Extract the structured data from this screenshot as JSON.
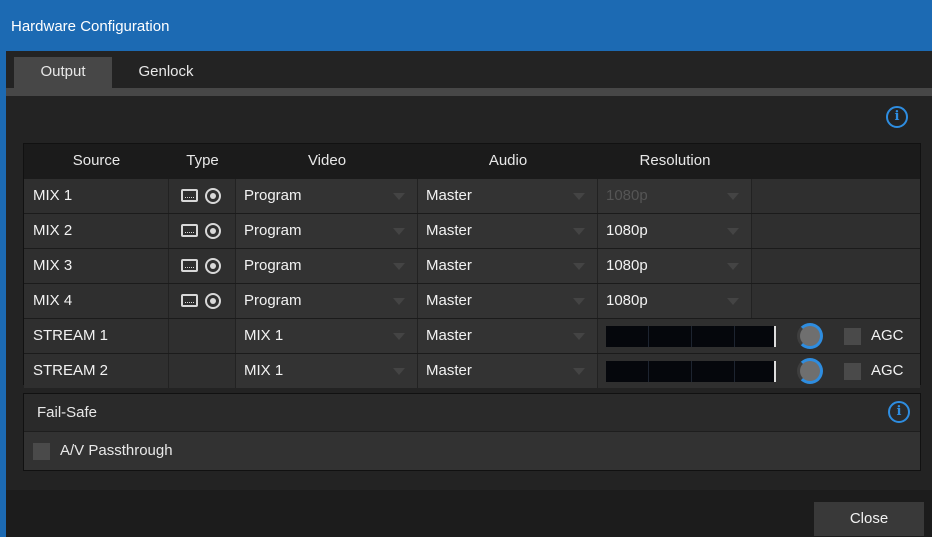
{
  "window": {
    "title": "Hardware Configuration"
  },
  "tabs": [
    {
      "label": "Output",
      "active": true
    },
    {
      "label": "Genlock",
      "active": false
    }
  ],
  "table": {
    "headers": {
      "source": "Source",
      "type": "Type",
      "video": "Video",
      "audio": "Audio",
      "resolution": "Resolution"
    },
    "rows": [
      {
        "source": "MIX 1",
        "video": "Program",
        "audio": "Master",
        "resolution": "1080p",
        "resolution_disabled": true
      },
      {
        "source": "MIX 2",
        "video": "Program",
        "audio": "Master",
        "resolution": "1080p"
      },
      {
        "source": "MIX 3",
        "video": "Program",
        "audio": "Master",
        "resolution": "1080p"
      },
      {
        "source": "MIX 4",
        "video": "Program",
        "audio": "Master",
        "resolution": "1080p"
      },
      {
        "source": "STREAM 1",
        "video": "MIX 1",
        "audio": "Master",
        "agc": "AGC",
        "agc_checked": false
      },
      {
        "source": "STREAM 2",
        "video": "MIX 1",
        "audio": "Master",
        "agc": "AGC",
        "agc_checked": false
      }
    ]
  },
  "failsafe": {
    "title": "Fail-Safe",
    "passthrough_label": "A/V Passthrough",
    "passthrough_checked": false
  },
  "footer": {
    "close_label": "Close"
  },
  "icons": {
    "info": "info-icon",
    "camera": "camera-icon",
    "record": "record-icon",
    "dropdown": "chevron-down-icon"
  },
  "colors": {
    "accent": "#1c6ab3",
    "info": "#2e8de0"
  }
}
